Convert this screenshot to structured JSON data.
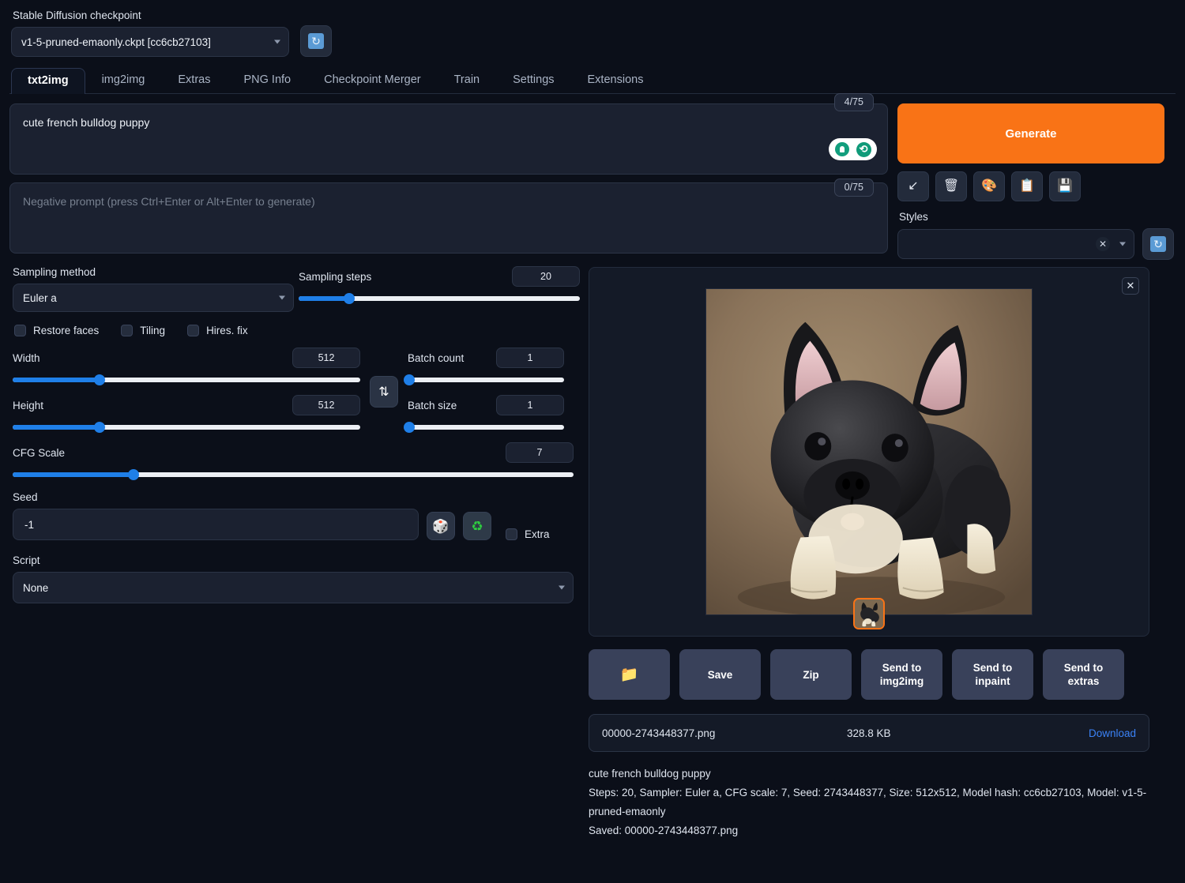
{
  "checkpoint": {
    "label": "Stable Diffusion checkpoint",
    "value": "v1-5-pruned-emaonly.ckpt [cc6cb27103]",
    "refresh_icon": "refresh-icon"
  },
  "tabs": [
    {
      "label": "txt2img",
      "active": true
    },
    {
      "label": "img2img",
      "active": false
    },
    {
      "label": "Extras",
      "active": false
    },
    {
      "label": "PNG Info",
      "active": false
    },
    {
      "label": "Checkpoint Merger",
      "active": false
    },
    {
      "label": "Train",
      "active": false
    },
    {
      "label": "Settings",
      "active": false
    },
    {
      "label": "Extensions",
      "active": false
    }
  ],
  "prompt": {
    "positive_value": "cute french bulldog puppy",
    "positive_counter": "4/75",
    "negative_placeholder": "Negative prompt (press Ctrl+Enter or Alt+Enter to generate)",
    "negative_counter": "0/75",
    "tools": [
      "lightbulb-icon",
      "restore-progress-icon"
    ]
  },
  "generate": {
    "label": "Generate",
    "accent_color": "#f97316",
    "tools": [
      {
        "name": "read-generation-params-icon",
        "glyph": "↙"
      },
      {
        "name": "clear-prompt-trash-icon",
        "glyph": "🗑"
      },
      {
        "name": "apply-style-icon",
        "glyph": "🎨"
      },
      {
        "name": "paste-clipboard-icon",
        "glyph": "📋"
      },
      {
        "name": "save-style-floppy-icon",
        "glyph": "💾"
      }
    ]
  },
  "styles": {
    "label": "Styles",
    "value": "",
    "clear_icon": "clear-x-icon",
    "refresh_icon": "refresh-icon"
  },
  "settings": {
    "sampling_method": {
      "label": "Sampling method",
      "value": "Euler a"
    },
    "sampling_steps": {
      "label": "Sampling steps",
      "value": "20",
      "percent": 18
    },
    "checkboxes": [
      {
        "label": "Restore faces",
        "checked": false
      },
      {
        "label": "Tiling",
        "checked": false
      },
      {
        "label": "Hires. fix",
        "checked": false
      }
    ],
    "width": {
      "label": "Width",
      "value": "512",
      "percent": 25
    },
    "height": {
      "label": "Height",
      "value": "512",
      "percent": 25
    },
    "cfg_scale": {
      "label": "CFG Scale",
      "value": "7",
      "percent": 21
    },
    "batch_count": {
      "label": "Batch count",
      "value": "1",
      "percent": 0
    },
    "batch_size": {
      "label": "Batch size",
      "value": "1",
      "percent": 0
    },
    "swap_icon": "swap-dimensions-icon",
    "seed": {
      "label": "Seed",
      "value": "-1"
    },
    "seed_random_icon": "dice-random-icon",
    "seed_recycle_icon": "recycle-reuse-seed-icon",
    "extra_checkbox": {
      "label": "Extra",
      "checked": false
    },
    "script": {
      "label": "Script",
      "value": "None"
    }
  },
  "result": {
    "close_icon": "close-icon",
    "image_alt": "generated french bulldog puppy",
    "thumbnail_selected": true,
    "buttons": [
      {
        "name": "open-folder-button",
        "label": "",
        "icon": "folder-icon"
      },
      {
        "name": "save-button",
        "label": "Save",
        "icon": ""
      },
      {
        "name": "zip-button",
        "label": "Zip",
        "icon": ""
      },
      {
        "name": "send-to-img2img-button",
        "label": "Send to img2img",
        "icon": ""
      },
      {
        "name": "send-to-inpaint-button",
        "label": "Send to inpaint",
        "icon": ""
      },
      {
        "name": "send-to-extras-button",
        "label": "Send to extras",
        "icon": ""
      }
    ],
    "file": {
      "name": "00000-2743448377.png",
      "size": "328.8 KB",
      "download_label": "Download"
    },
    "metadata": {
      "line1": "cute french bulldog puppy",
      "line2": "Steps: 20, Sampler: Euler a, CFG scale: 7, Seed: 2743448377, Size: 512x512, Model hash: cc6cb27103, Model: v1-5-pruned-emaonly",
      "line3": "Saved: 00000-2743448377.png"
    }
  }
}
